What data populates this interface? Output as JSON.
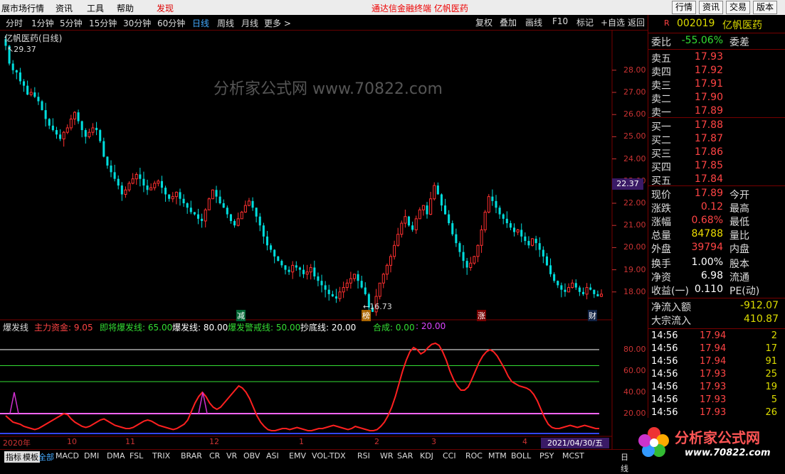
{
  "menubar": {
    "items": [
      "展市场行情",
      "资讯",
      "工具",
      "帮助",
      "发现"
    ],
    "center_text": "通达信金融终端   亿帆医药",
    "right_buttons": [
      "行情",
      "资讯",
      "交易",
      "版本"
    ]
  },
  "periodbar": {
    "periods": [
      "分时",
      "1分钟",
      "5分钟",
      "15分钟",
      "30分钟",
      "60分钟",
      "日线",
      "周线",
      "月线",
      "更多 >"
    ],
    "selected": "日线",
    "tools": [
      "复权",
      "叠加",
      "画线",
      "F10",
      "标记",
      "+自选",
      "返回"
    ]
  },
  "main_chart": {
    "title": "亿帆医药(日线)",
    "high_label": "29.37",
    "low_label": "16.73",
    "price_flag": "22.37",
    "axis": [
      "28.00",
      "27.00",
      "26.00",
      "25.00",
      "24.00",
      "23.00",
      "22.00",
      "21.00",
      "20.00",
      "19.00",
      "18.00"
    ],
    "markers": [
      "减",
      "榜",
      "涨",
      "财"
    ],
    "watermark": "分析家公式网 www.70822.com"
  },
  "chart_data": {
    "type": "candlestick",
    "ylim": [
      17,
      29.5
    ],
    "axis_ticks": [
      28,
      27,
      26,
      25,
      24,
      23,
      22,
      21,
      20,
      19,
      18
    ],
    "closes": [
      29.1,
      28.3,
      28.0,
      27.9,
      27.5,
      27.3,
      26.9,
      27.0,
      26.8,
      26.6,
      26.2,
      25.8,
      25.5,
      25.3,
      25.1,
      24.9,
      25.2,
      25.4,
      25.8,
      26.1,
      25.7,
      25.3,
      25.0,
      25.2,
      25.4,
      25.3,
      24.8,
      24.1,
      23.7,
      23.4,
      23.1,
      22.8,
      22.4,
      22.6,
      22.9,
      23.1,
      23.3,
      23.1,
      22.8,
      22.6,
      22.7,
      22.9,
      23.0,
      22.7,
      22.4,
      22.2,
      22.3,
      22.5,
      22.2,
      22.0,
      21.8,
      21.6,
      21.5,
      21.3,
      21.2,
      21.7,
      22.2,
      22.6,
      22.3,
      22.0,
      21.8,
      21.5,
      21.2,
      21.0,
      21.3,
      21.6,
      21.9,
      22.1,
      21.8,
      21.4,
      21.0,
      20.5,
      20.1,
      19.9,
      19.6,
      19.4,
      19.2,
      19.0,
      18.9,
      19.2,
      19.1,
      19.0,
      18.8,
      18.9,
      19.1,
      18.7,
      18.5,
      18.3,
      18.1,
      17.9,
      17.8,
      17.7,
      18.0,
      18.2,
      18.4,
      18.6,
      18.8,
      18.5,
      18.2,
      17.9,
      17.3,
      17.1,
      17.8,
      18.4,
      18.8,
      19.2,
      19.6,
      20.1,
      20.6,
      21.1,
      21.4,
      21.0,
      20.8,
      21.3,
      21.7,
      21.9,
      21.5,
      22.2,
      22.8,
      22.4,
      21.9,
      21.5,
      21.1,
      20.6,
      20.2,
      19.8,
      19.4,
      19.1,
      19.3,
      19.6,
      20.1,
      20.8,
      21.6,
      22.3,
      22.1,
      21.8,
      21.5,
      21.3,
      21.1,
      20.9,
      20.7,
      20.8,
      20.5,
      20.3,
      20.1,
      20.4,
      20.2,
      19.9,
      19.6,
      19.2,
      18.8,
      18.5,
      18.3,
      18.1,
      18.0,
      18.2,
      18.4,
      18.2,
      18.0,
      17.9,
      18.2,
      18.1,
      17.9,
      17.8,
      17.9
    ],
    "indicator": {
      "name": "爆发线",
      "ylim": [
        0,
        100
      ],
      "axis_ticks": [
        80,
        60,
        40,
        20
      ],
      "levels": [
        80,
        65,
        50,
        20
      ],
      "values": [
        18,
        15,
        12,
        11,
        10,
        8,
        7,
        6,
        5,
        6,
        8,
        10,
        12,
        14,
        16,
        18,
        20,
        19,
        15,
        12,
        10,
        8,
        7,
        8,
        10,
        12,
        14,
        15,
        13,
        11,
        9,
        8,
        7,
        6,
        6,
        7,
        9,
        11,
        13,
        14,
        13,
        11,
        9,
        8,
        7,
        6,
        5,
        6,
        8,
        10,
        14,
        22,
        30,
        36,
        40,
        36,
        30,
        26,
        24,
        26,
        30,
        34,
        38,
        42,
        46,
        44,
        40,
        34,
        26,
        18,
        12,
        8,
        5,
        4,
        4,
        5,
        6,
        6,
        5,
        6,
        7,
        6,
        5,
        4,
        4,
        5,
        6,
        6,
        7,
        8,
        9,
        8,
        7,
        6,
        5,
        6,
        8,
        7,
        6,
        5,
        4,
        4,
        5,
        8,
        12,
        18,
        26,
        36,
        48,
        60,
        70,
        78,
        82,
        80,
        76,
        78,
        82,
        85,
        86,
        84,
        78,
        70,
        60,
        52,
        46,
        42,
        42,
        45,
        52,
        60,
        68,
        74,
        78,
        80,
        78,
        74,
        68,
        62,
        55,
        50,
        48,
        46,
        45,
        44,
        42,
        38,
        32,
        24,
        16,
        10,
        7,
        6,
        6,
        7,
        8,
        9,
        8,
        7,
        8,
        9,
        8,
        7,
        6,
        6
      ]
    },
    "months": [
      "2020年",
      "10",
      "11",
      "12",
      "1",
      "2",
      "3",
      "4"
    ]
  },
  "indicator_header": {
    "name": "爆发线",
    "main_fund": "主力资金: 9.05",
    "near_line": "即将爆发线: 65.00",
    "burst_line": "爆发线: 80.00",
    "alert_line": "爆发警戒线: 50.00",
    "bottom_line": "抄底线: 20.00",
    "sum_label": "合成: 0.00",
    "sum_value": ": 20.00",
    "axis": [
      "80.00",
      "60.00",
      "40.00",
      "20.00"
    ]
  },
  "date_box": "2021/04/30/五",
  "bottom_tabs": {
    "tabs": [
      "指标",
      "模板",
      "全部",
      "MACD",
      "DMI",
      "DMA",
      "FSL",
      "TRIX",
      "BRAR",
      "CR",
      "VR",
      "OBV",
      "ASI",
      "EMV",
      "VOL-TDX",
      "RSI",
      "WR",
      "SAR",
      "KDJ",
      "CCI",
      "ROC",
      "MTM",
      "BOLL",
      "PSY",
      "MCST"
    ],
    "right": "日线"
  },
  "quote": {
    "code": "002019",
    "name": "亿帆医药",
    "wei_bi": "-55.06%",
    "wei_cha": "委差",
    "sells": [
      [
        "卖五",
        "17.93"
      ],
      [
        "卖四",
        "17.92"
      ],
      [
        "卖三",
        "17.91"
      ],
      [
        "卖二",
        "17.90"
      ],
      [
        "卖一",
        "17.89"
      ]
    ],
    "buys": [
      [
        "买一",
        "17.88"
      ],
      [
        "买二",
        "17.87"
      ],
      [
        "买三",
        "17.86"
      ],
      [
        "买四",
        "17.85"
      ],
      [
        "买五",
        "17.84"
      ]
    ],
    "stats": [
      [
        "现价",
        "17.89",
        "今开"
      ],
      [
        "涨跌",
        "0.12",
        "最高"
      ],
      [
        "涨幅",
        "0.68%",
        "最低"
      ],
      [
        "总量",
        "84788",
        "量比"
      ],
      [
        "外盘",
        "39794",
        "内盘"
      ],
      [
        "换手",
        "1.00%",
        "股本"
      ],
      [
        "净资",
        "6.98",
        "流通"
      ],
      [
        "收益(一)",
        "0.110",
        "PE(动)"
      ]
    ],
    "net_inflow_label": "净流入额",
    "net_inflow": "-912.07",
    "block_label": "大宗流入",
    "block": "410.87",
    "ticks": [
      [
        "14:56",
        "17.94",
        "2"
      ],
      [
        "14:56",
        "17.94",
        "17"
      ],
      [
        "14:56",
        "17.94",
        "91"
      ],
      [
        "14:56",
        "17.93",
        "25"
      ],
      [
        "14:56",
        "17.93",
        "19"
      ],
      [
        "14:56",
        "17.93",
        "5"
      ],
      [
        "14:56",
        "17.93",
        "26"
      ]
    ]
  },
  "logo": {
    "title": "分析家公式网",
    "url": "www.70822.com"
  }
}
